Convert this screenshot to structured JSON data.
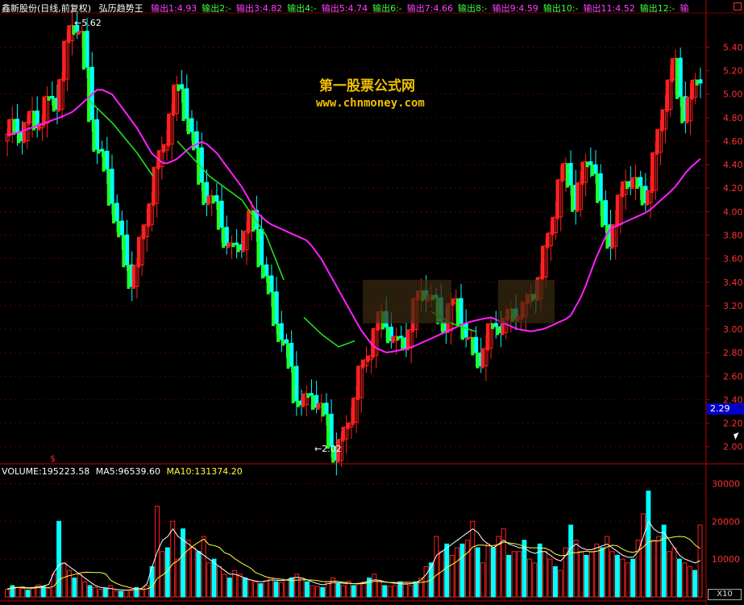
{
  "header": {
    "stock_name": "鑫新股份",
    "period": "(日线,前复权)",
    "indicator": "弘历趋势王",
    "outputs": [
      {
        "label": "输出1:4.93",
        "color": "#ff40ff"
      },
      {
        "label": "输出2:-",
        "color": "#40ff40"
      },
      {
        "label": "输出3:4.82",
        "color": "#ff40ff"
      },
      {
        "label": "输出4:-",
        "color": "#40ff40"
      },
      {
        "label": "输出5:4.74",
        "color": "#ff40ff"
      },
      {
        "label": "输出6:-",
        "color": "#40ff40"
      },
      {
        "label": "输出7:4.66",
        "color": "#ff40ff"
      },
      {
        "label": "输出8:-",
        "color": "#40ff40"
      },
      {
        "label": "输出9:4.59",
        "color": "#ff40ff"
      },
      {
        "label": "输出10:-",
        "color": "#40ff40"
      },
      {
        "label": "输出11:4.52",
        "color": "#ff40ff"
      },
      {
        "label": "输出12:-",
        "color": "#40ff40"
      },
      {
        "label": "输",
        "color": "#ff40ff"
      }
    ]
  },
  "watermark": {
    "title": "第一股票公式网",
    "url": "www.chnmoney.com"
  },
  "annotations": {
    "high_label": "5.62",
    "low_label": "2.02",
    "current_price": "2.29",
    "marker": "$"
  },
  "volume_header": {
    "volume": "VOLUME:195223.58",
    "ma5": "MA5:96539.60",
    "ma10": "MA10:131374.20"
  },
  "scale_button": "X10",
  "colors": {
    "up": "#ff2020",
    "down": "#00ffff",
    "trend_up": "#ff2020",
    "trend_down": "#20ff20",
    "ma_line": "#ff20ff",
    "resistance_line": "#20e020",
    "grid": "#800000",
    "axis_text": "#ff3030",
    "vol_ma5": "#ffffff",
    "vol_ma10": "#ffff40"
  },
  "chart_data": [
    {
      "type": "candlestick",
      "title": "",
      "ylim": [
        1.95,
        5.65
      ],
      "yticks": [
        2.0,
        2.2,
        2.4,
        2.6,
        2.8,
        3.0,
        3.2,
        3.4,
        3.6,
        3.8,
        4.0,
        4.2,
        4.4,
        4.6,
        4.8,
        5.0,
        5.2,
        5.4
      ],
      "high": 5.62,
      "low": 2.02,
      "last": 2.29,
      "close_path": [
        4.6,
        4.7,
        4.75,
        4.8,
        4.7,
        4.9,
        5.0,
        5.3,
        5.6,
        5.5,
        5.0,
        4.6,
        4.3,
        4.0,
        3.7,
        3.5,
        3.55,
        3.9,
        4.3,
        4.6,
        4.9,
        5.0,
        4.8,
        4.5,
        4.2,
        4.0,
        3.9,
        3.7,
        3.75,
        3.8,
        3.9,
        3.6,
        3.3,
        3.0,
        2.7,
        2.5,
        2.4,
        2.45,
        2.3,
        2.1,
        2.0,
        2.1,
        2.3,
        2.6,
        2.9,
        3.1,
        3.0,
        2.85,
        2.9,
        3.1,
        3.25,
        3.3,
        3.2,
        3.1,
        3.2,
        3.05,
        2.9,
        2.8,
        2.85,
        2.95,
        3.05,
        3.15,
        3.2,
        3.1,
        3.3,
        3.6,
        3.9,
        4.2,
        4.3,
        4.1,
        4.4,
        4.5,
        3.9,
        3.8,
        4.0,
        4.3,
        4.2,
        4.1,
        4.3,
        4.6,
        5.0,
        5.2,
        4.9,
        5.0,
        5.1
      ],
      "ma_path": [
        4.65,
        4.68,
        4.72,
        4.76,
        4.8,
        4.85,
        4.95,
        5.05,
        5.0,
        4.85,
        4.7,
        4.5,
        4.4,
        4.45,
        4.55,
        4.6,
        4.5,
        4.35,
        4.2,
        4.0,
        3.9,
        3.85,
        3.8,
        3.75,
        3.6,
        3.4,
        3.2,
        3.0,
        2.85,
        2.8,
        2.82,
        2.85,
        2.9,
        2.95,
        3.0,
        3.05,
        3.08,
        3.1,
        3.05,
        3.0,
        2.98,
        3.0,
        3.05,
        3.1,
        3.3,
        3.6,
        3.85,
        3.9,
        3.95,
        4.0,
        4.1,
        4.2,
        4.35,
        4.45
      ]
    },
    {
      "type": "bar",
      "title": "",
      "ylim": [
        0,
        32000
      ],
      "yticks": [
        10000,
        20000,
        30000
      ],
      "series": [
        {
          "name": "VOLUME",
          "last": 195223.58
        },
        {
          "name": "MA5",
          "last": 96539.6
        },
        {
          "name": "MA10",
          "last": 131374.2
        }
      ],
      "values": [
        2000,
        3000,
        2500,
        2200,
        1800,
        2400,
        3200,
        2800,
        2200,
        6000,
        20000,
        9000,
        7000,
        5000,
        6000,
        4000,
        3000,
        2500,
        2000,
        2200,
        3000,
        1600,
        1500,
        1800,
        1700,
        2500,
        1900,
        3000,
        8000,
        24000,
        12000,
        13000,
        20000,
        10000,
        18000,
        15000,
        13000,
        12000,
        16000,
        9000,
        10000,
        8000,
        6000,
        5000,
        7000,
        6000,
        5000,
        4500,
        4000,
        3500,
        4200,
        5000,
        4000,
        3800,
        4500,
        5000,
        6000,
        5000,
        4000,
        3000,
        2800,
        2500,
        4000,
        5000,
        3500,
        3000,
        4200,
        3000,
        3500,
        4000,
        5000,
        6000,
        4000,
        3000,
        2800,
        3000,
        4000,
        3500,
        3000,
        4000,
        5000,
        8000,
        9000,
        16000,
        12000,
        14000,
        11000,
        13000,
        14000,
        15000,
        20000,
        13000,
        9000,
        14000,
        13000,
        16000,
        18000,
        11000,
        12000,
        12000,
        15000,
        10000,
        9000,
        14000,
        12000,
        10000,
        8000,
        7000,
        13000,
        19000,
        15000,
        12000,
        11000,
        12000,
        14000,
        13000,
        16000,
        12000,
        11000,
        10000,
        9000,
        10000,
        15000,
        22000,
        28000,
        15000,
        16000,
        19000,
        12000,
        13000,
        10000,
        9000,
        8000,
        7000,
        19000
      ],
      "ma5": [
        2200,
        2300,
        2500,
        2600,
        2400,
        2500,
        2700,
        2900,
        3300,
        6500,
        8500,
        9000,
        8000,
        7000,
        6000,
        5000,
        4000,
        3000,
        2500,
        2400,
        2200,
        2000,
        1900,
        1800,
        1900,
        2000,
        2300,
        3500,
        8000,
        12000,
        15000,
        16000,
        18000,
        16000,
        15000,
        14000,
        13000,
        12000,
        11000,
        10000,
        9000,
        8000,
        7000,
        6000,
        6000,
        5500,
        5000,
        4500,
        4200,
        4000,
        4200,
        4500,
        4400,
        4300,
        4500,
        5000,
        5200,
        5000,
        4500,
        4000,
        3500,
        3200,
        3500,
        3800,
        3800,
        3600,
        3600,
        3500,
        3600,
        3800,
        4200,
        4500,
        4400,
        4000,
        3800,
        3600,
        3500,
        3400,
        3500,
        3800,
        4500,
        6000,
        8000,
        11000,
        12000,
        13000,
        14000,
        15000,
        16000,
        17000,
        18000,
        17000,
        15000,
        14000,
        13000,
        14000,
        15000,
        14000,
        13500,
        13000,
        13000,
        12000,
        11500,
        12000,
        12000,
        11000,
        10000,
        9500,
        11000,
        13000,
        14000,
        13000,
        12500,
        12500,
        13000,
        13500,
        14000,
        13000,
        12000,
        11000,
        10500,
        10500,
        12000,
        16000,
        20000,
        18000,
        17000,
        17000,
        15000,
        13000,
        11000,
        10000,
        9500,
        9000,
        9600
      ]
    }
  ]
}
